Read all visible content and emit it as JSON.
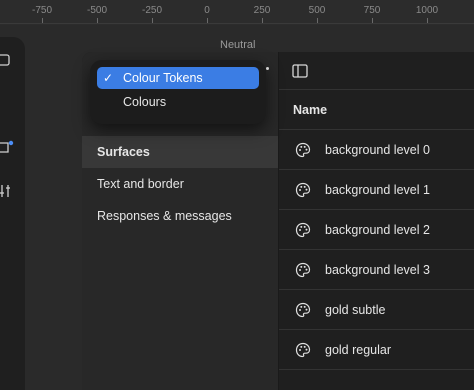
{
  "ruler": {
    "ticks": [
      "-750",
      "-500",
      "-250",
      "0",
      "250",
      "500",
      "750",
      "1000"
    ]
  },
  "canvas": {
    "frame_label": "Neutral"
  },
  "dropdown": {
    "items": [
      {
        "label": "Colour Tokens",
        "selected": true
      },
      {
        "label": "Colours",
        "selected": false
      }
    ],
    "accent": "#3b7de4"
  },
  "sidebar": {
    "items": [
      {
        "label": "Surfaces",
        "active": true
      },
      {
        "label": "Text and border",
        "active": false
      },
      {
        "label": "Responses & messages",
        "active": false
      }
    ]
  },
  "table": {
    "header": "Name",
    "rows": [
      {
        "icon": "palette-icon",
        "name": "background level 0"
      },
      {
        "icon": "palette-icon",
        "name": "background level 1"
      },
      {
        "icon": "palette-icon",
        "name": "background level 2"
      },
      {
        "icon": "palette-icon",
        "name": "background level 3"
      },
      {
        "icon": "palette-icon",
        "name": "gold subtle"
      },
      {
        "icon": "palette-icon",
        "name": "gold regular"
      }
    ]
  }
}
